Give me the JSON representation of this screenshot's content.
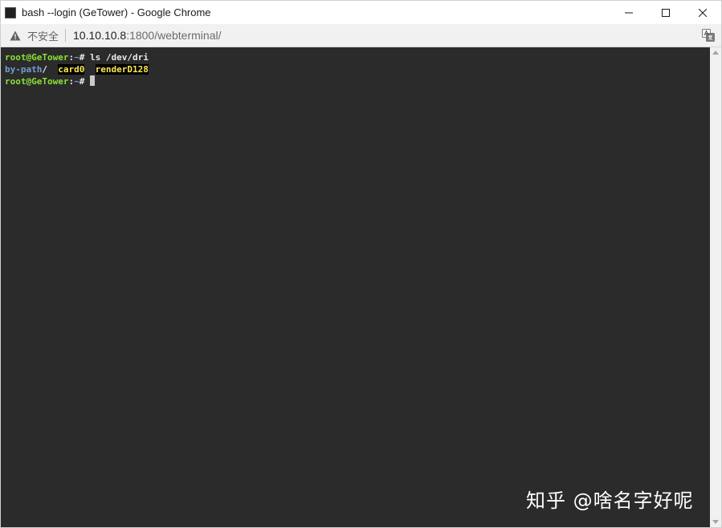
{
  "window": {
    "title": "bash --login (GeTower) - Google Chrome",
    "controls": [
      "minimize",
      "maximize",
      "close"
    ]
  },
  "addressbar": {
    "security_label": "不安全",
    "url_host": "10.10.10.8",
    "url_rest": ":1800/webterminal/"
  },
  "terminal": {
    "prompt_user": "root@GeTower",
    "prompt_sep": ":",
    "prompt_path": "~",
    "prompt_symbol": "# ",
    "command": "ls /dev/dri",
    "output": {
      "dir_entry": "by-path",
      "dir_suffix": "/",
      "device_1": "card0",
      "device_2": "renderD128"
    },
    "colors": {
      "background": "#2b2b2b",
      "user": "#8ae234",
      "path": "#729fcf",
      "device": "#fce94f"
    }
  },
  "watermark": {
    "text": "知乎 @啥名字好呢"
  }
}
